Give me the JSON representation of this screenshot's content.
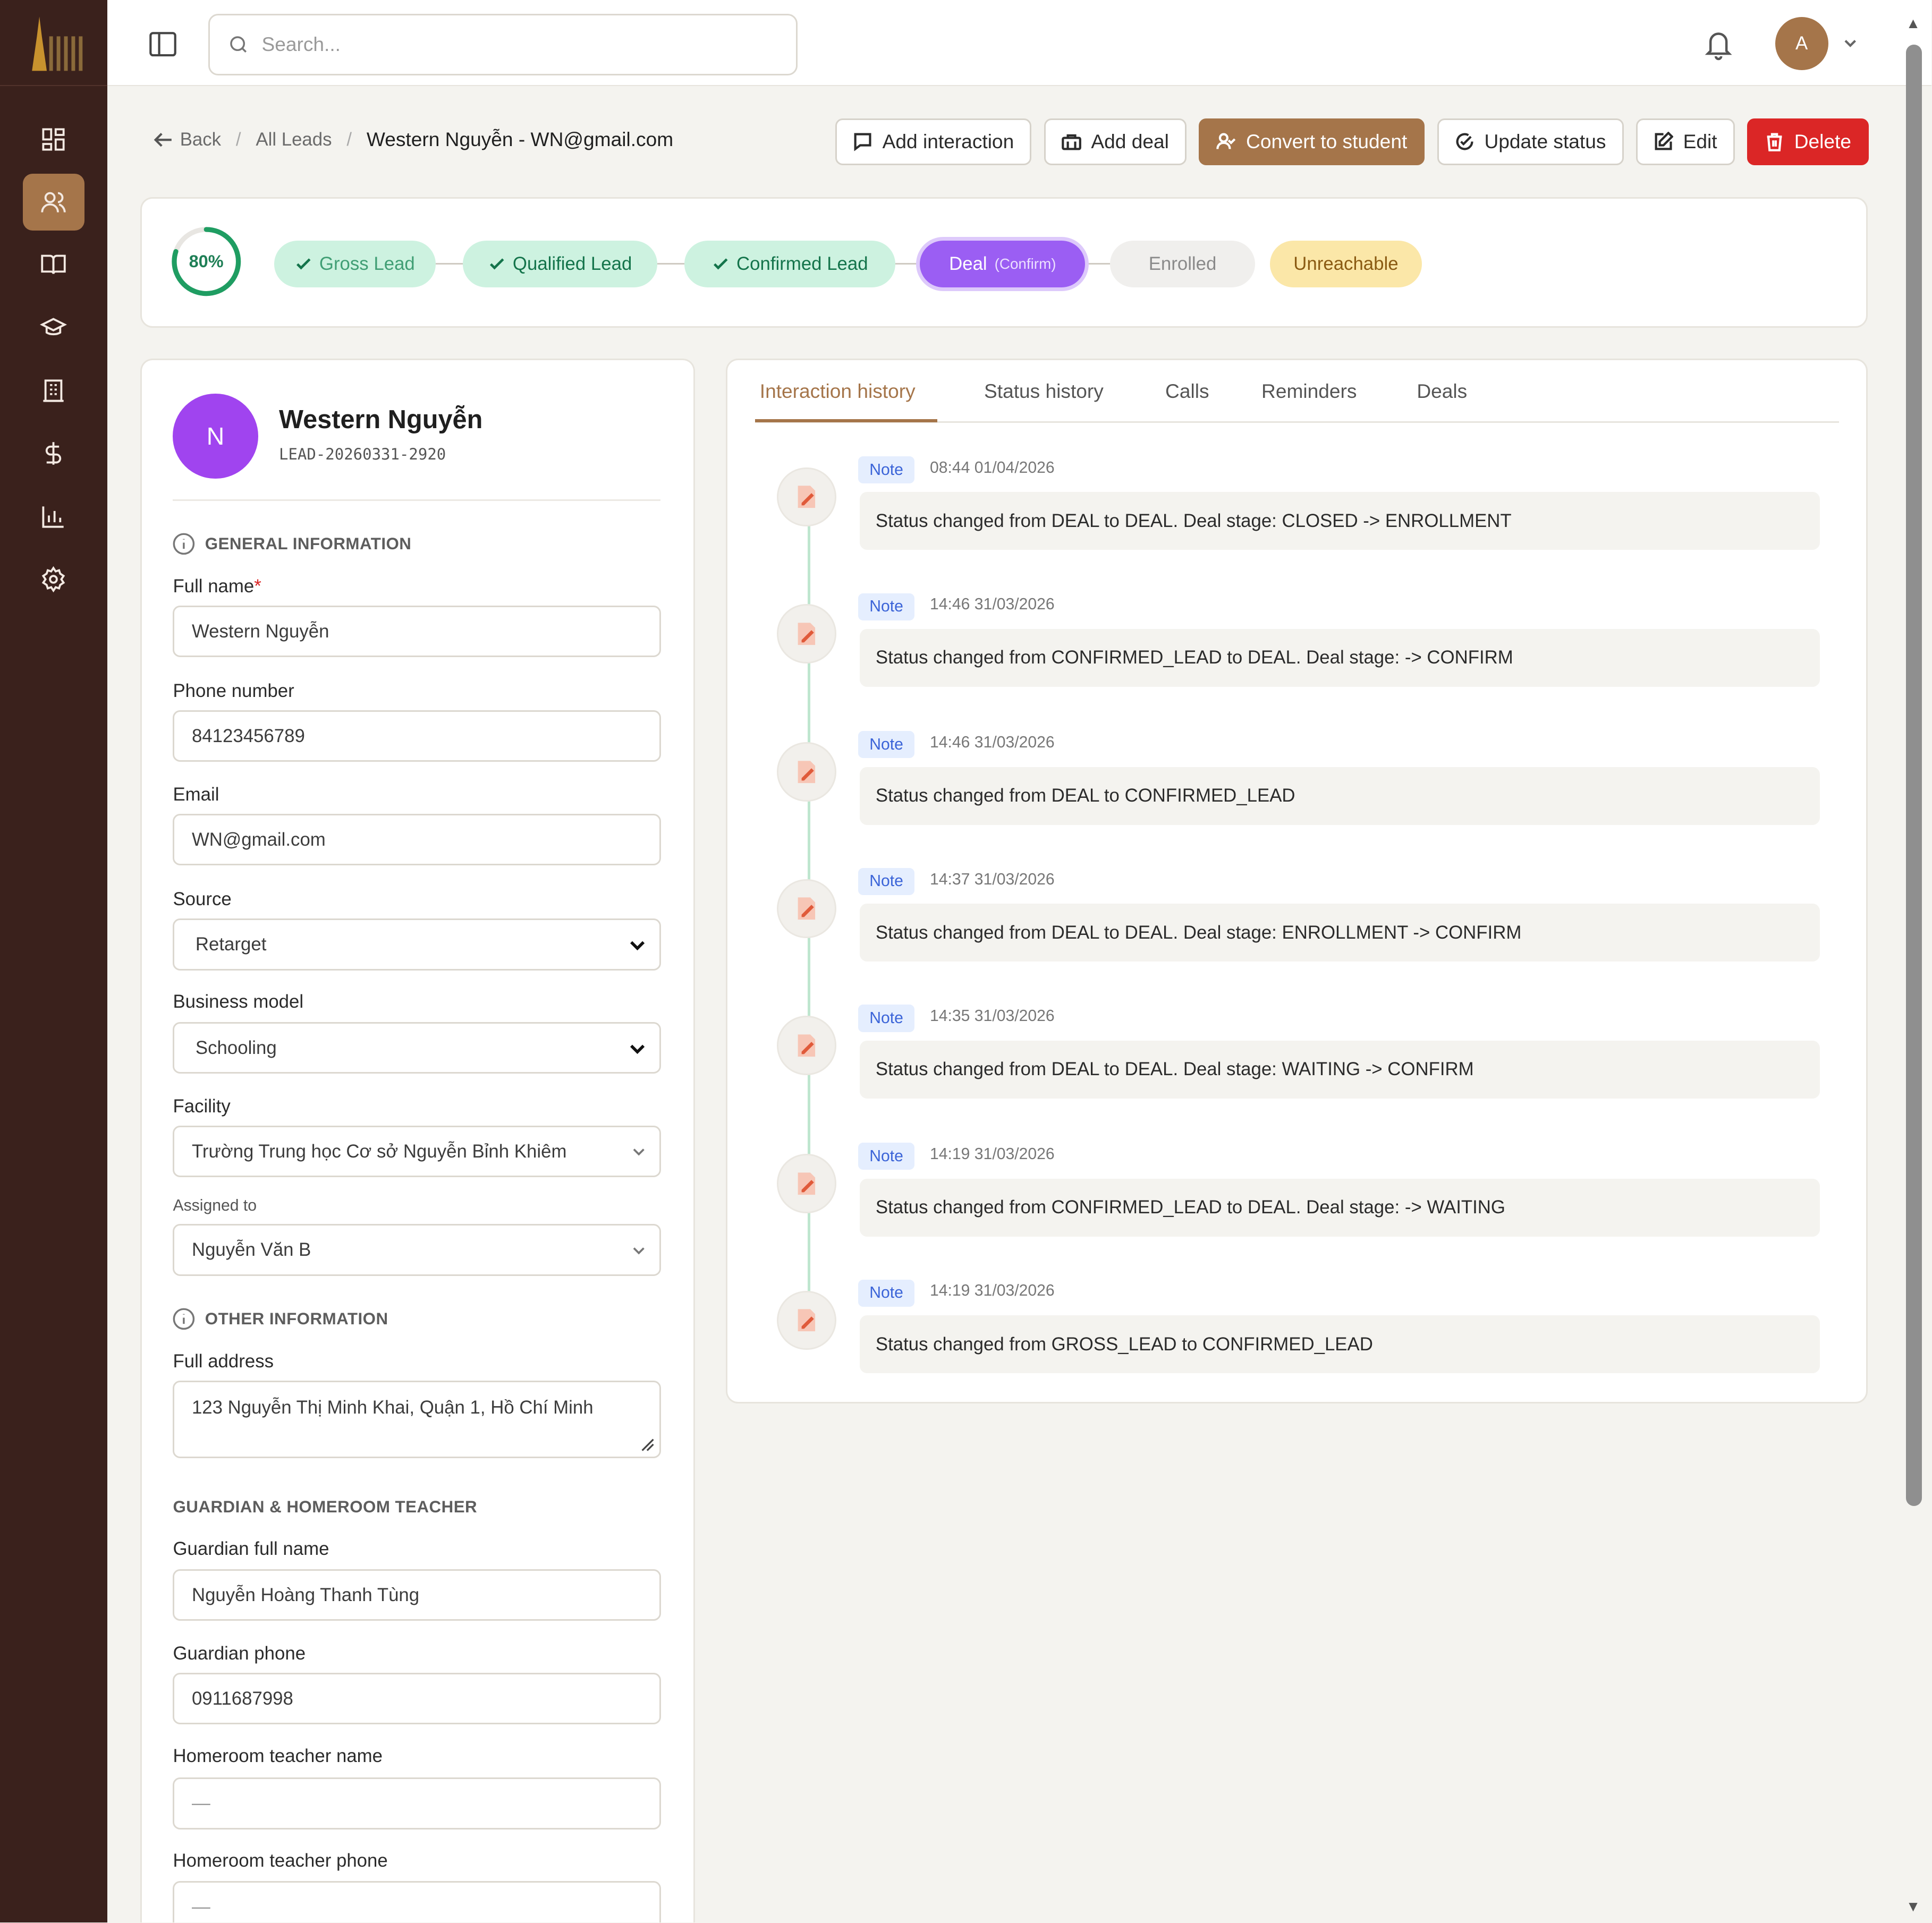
{
  "search": {
    "placeholder": "Search..."
  },
  "user": {
    "initial": "A"
  },
  "breadcrumb": {
    "back": "Back",
    "all_leads": "All Leads",
    "current": "Western Nguyễn - WN@gmail.com",
    "sep": "/"
  },
  "actions": {
    "add_interaction": "Add interaction",
    "add_deal": "Add deal",
    "convert": "Convert to student",
    "update_status": "Update status",
    "edit": "Edit",
    "delete": "Delete"
  },
  "pipeline": {
    "progress": "80%",
    "progress_value": 0.8,
    "gross": "Gross Lead",
    "qualified": "Qualified Lead",
    "confirmed": "Confirmed Lead",
    "deal": "Deal",
    "deal_stage": "(Confirm)",
    "enrolled": "Enrolled",
    "unreachable": "Unreachable"
  },
  "profile": {
    "initial": "N",
    "name": "Western Nguyễn",
    "code": "LEAD-20260331-2920",
    "general_title": "GENERAL INFORMATION",
    "full_name_label": "Full name",
    "required_mark": "*",
    "full_name": "Western Nguyễn",
    "phone_label": "Phone number",
    "phone": "84123456789",
    "email_label": "Email",
    "email": "WN@gmail.com",
    "source_label": "Source",
    "source": "Retarget",
    "model_label": "Business model",
    "model": "Schooling",
    "facility_label": "Facility",
    "facility": "Trường Trung học Cơ sở Nguyễn Bỉnh Khiêm",
    "assigned_label": "Assigned to",
    "assigned": "Nguyễn Văn B",
    "other_title": "OTHER INFORMATION",
    "address_label": "Full address",
    "address": "123 Nguyễn Thị Minh Khai, Quận 1, Hồ Chí Minh",
    "guardian_title": "GUARDIAN & HOMEROOM TEACHER",
    "guardian_name_label": "Guardian full name",
    "guardian_name": "Nguyễn Hoàng Thanh Tùng",
    "guardian_phone_label": "Guardian phone",
    "guardian_phone": "0911687998",
    "teacher_name_label": "Homeroom teacher name",
    "teacher_name": "—",
    "teacher_phone_label": "Homeroom teacher phone",
    "teacher_phone": "—"
  },
  "tabs": [
    "Interaction history",
    "Status history",
    "Calls",
    "Reminders",
    "Deals"
  ],
  "history": [
    {
      "badge": "Note",
      "time": "08:44 01/04/2026",
      "text": "Status changed from DEAL to DEAL. Deal stage: CLOSED -> ENROLLMENT"
    },
    {
      "badge": "Note",
      "time": "14:46 31/03/2026",
      "text": "Status changed from CONFIRMED_LEAD to DEAL. Deal stage: -> CONFIRM"
    },
    {
      "badge": "Note",
      "time": "14:46 31/03/2026",
      "text": "Status changed from DEAL to CONFIRMED_LEAD"
    },
    {
      "badge": "Note",
      "time": "14:37 31/03/2026",
      "text": "Status changed from DEAL to DEAL. Deal stage: ENROLLMENT -> CONFIRM"
    },
    {
      "badge": "Note",
      "time": "14:35 31/03/2026",
      "text": "Status changed from DEAL to DEAL. Deal stage: WAITING -> CONFIRM"
    },
    {
      "badge": "Note",
      "time": "14:19 31/03/2026",
      "text": "Status changed from CONFIRMED_LEAD to DEAL. Deal stage: -> WAITING"
    },
    {
      "badge": "Note",
      "time": "14:19 31/03/2026",
      "text": "Status changed from GROSS_LEAD to CONFIRMED_LEAD"
    }
  ],
  "colors": {
    "sidebar": "#3a211c",
    "accent": "#a5754a",
    "danger": "#db2626",
    "deal": "#9b5ef3",
    "success": "#14744b"
  }
}
